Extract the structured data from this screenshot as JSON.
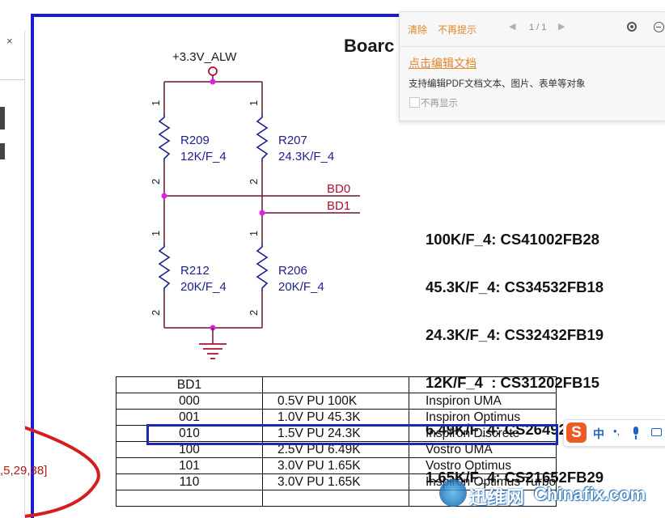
{
  "schematic": {
    "title_fragment": "Boarc",
    "power_rail": "+3.3V_ALW",
    "resistors": [
      {
        "ref": "R209",
        "value": "12K/F_4",
        "pin_top": "1",
        "pin_bottom": "2"
      },
      {
        "ref": "R207",
        "value": "24.3K/F_4",
        "pin_top": "1",
        "pin_bottom": "2"
      },
      {
        "ref": "R212",
        "value": "20K/F_4",
        "pin_top": "1",
        "pin_bottom": "2"
      },
      {
        "ref": "R206",
        "value": "20K/F_4",
        "pin_top": "1",
        "pin_bottom": "2"
      }
    ],
    "nets": [
      "BD0",
      "BD1"
    ],
    "parts_list": [
      "100K/F_4: CS41002FB28",
      "45.3K/F_4: CS34532FB18",
      "24.3K/F_4: CS32432FB19",
      "12K/F_4  : CS31202FB15",
      "6.49K/F_4: CS26492FB23",
      "1.65K/F_4: CS21652FB29"
    ],
    "colors": {
      "frame": "#1a1ad0",
      "wire": "#6b1530",
      "net_label": "#b01030",
      "node": "#e020e0",
      "resistor": "#1e1e8c"
    }
  },
  "table": {
    "header": [
      "BD1",
      "",
      ""
    ],
    "rows": [
      [
        "000",
        "0.5V  PU 100K",
        "Inspiron UMA"
      ],
      [
        "001",
        "1.0V  PU 45.3K",
        "Inspiron Optimus"
      ],
      [
        "010",
        "1.5V  PU 24.3K",
        "Inspiron Discrete"
      ],
      [
        "100",
        "2.5V  PU 6.49K",
        "Vostro UMA"
      ],
      [
        "101",
        "3.0V  PU 1.65K",
        "Vostro Optimus"
      ],
      [
        "110",
        "3.0V  PU 1.65K",
        "Inspiron Optimus Turbo"
      ],
      [
        "",
        "",
        ""
      ]
    ],
    "highlighted_row": "010"
  },
  "popup": {
    "clear": "清除",
    "no_more_hint": "不再提示",
    "page_counter": "1 / 1",
    "edit_link": "点击编辑文档",
    "description": "支持编辑PDF文档文本、图片、表单等对象",
    "checkbox_label": "不再显示",
    "icons": [
      "prev-arrow-icon",
      "next-arrow-icon",
      "settings-icon",
      "minimize-icon"
    ]
  },
  "left_panel": {
    "close": "×"
  },
  "ime": {
    "logo": "S",
    "mode": "中",
    "punct": "•,",
    "icons": [
      "sogou-logo-icon",
      "microphone-icon",
      "keyboard-icon"
    ]
  },
  "page_ref": ",5,29,38]",
  "watermark": {
    "cn": "迅维网",
    "en": "Chinafix.com"
  }
}
